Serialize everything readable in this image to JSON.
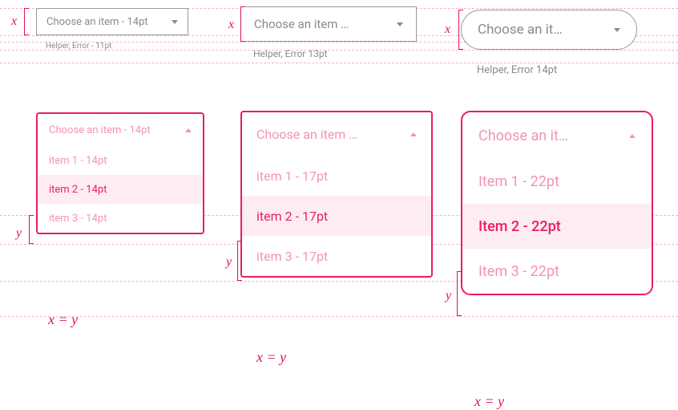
{
  "dims": {
    "x": "x",
    "y": "y",
    "formula": "x = y"
  },
  "small": {
    "placeholder": "Choose an item - 14pt",
    "helper": "Helper, Error - 11pt",
    "open_header": "Choose an item - 14pt",
    "items": [
      "item 1 - 14pt",
      "item 2 - 14pt",
      "item 3 - 14pt"
    ]
  },
  "medium": {
    "placeholder": "Choose an item …",
    "helper": "Helper, Error 13pt",
    "open_header": "Choose an item …",
    "items": [
      "item 1 - 17pt",
      "item 2 - 17pt",
      "item 3 - 17pt"
    ]
  },
  "large": {
    "placeholder": "Choose an it…",
    "helper": "Helper, Error 14pt",
    "open_header": "Choose an it…",
    "items": [
      "Item 1 - 22pt",
      "Item 2 - 22pt",
      "Item 3 - 22pt"
    ]
  }
}
